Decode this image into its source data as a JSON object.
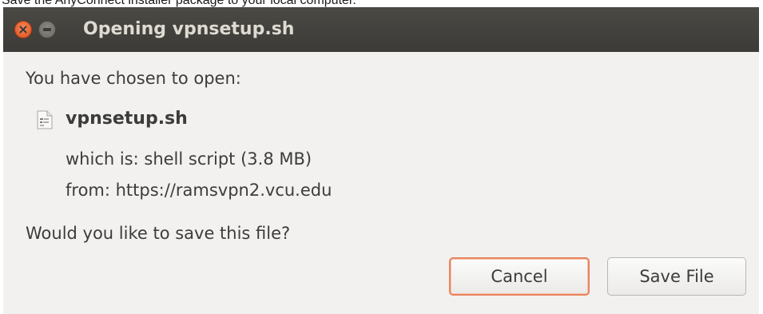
{
  "caption": "Save the AnyConnect installer package to your local computer.",
  "dialog": {
    "title": "Opening vpnsetup.sh",
    "intro": "You have chosen to open:",
    "filename": "vpnsetup.sh",
    "which_is": "which is:  shell script (3.8 MB)",
    "from": "from:  https://ramsvpn2.vcu.edu",
    "question": "Would you like to save this file?",
    "buttons": {
      "cancel": "Cancel",
      "save": "Save File"
    },
    "icons": {
      "close": "close-icon",
      "minimize": "minimize-icon",
      "file": "file-icon"
    },
    "colors": {
      "titlebar": "#3c3b37",
      "close_button": "#df4a16",
      "focus_ring": "#e8835d",
      "background": "#f2f1f0"
    }
  }
}
